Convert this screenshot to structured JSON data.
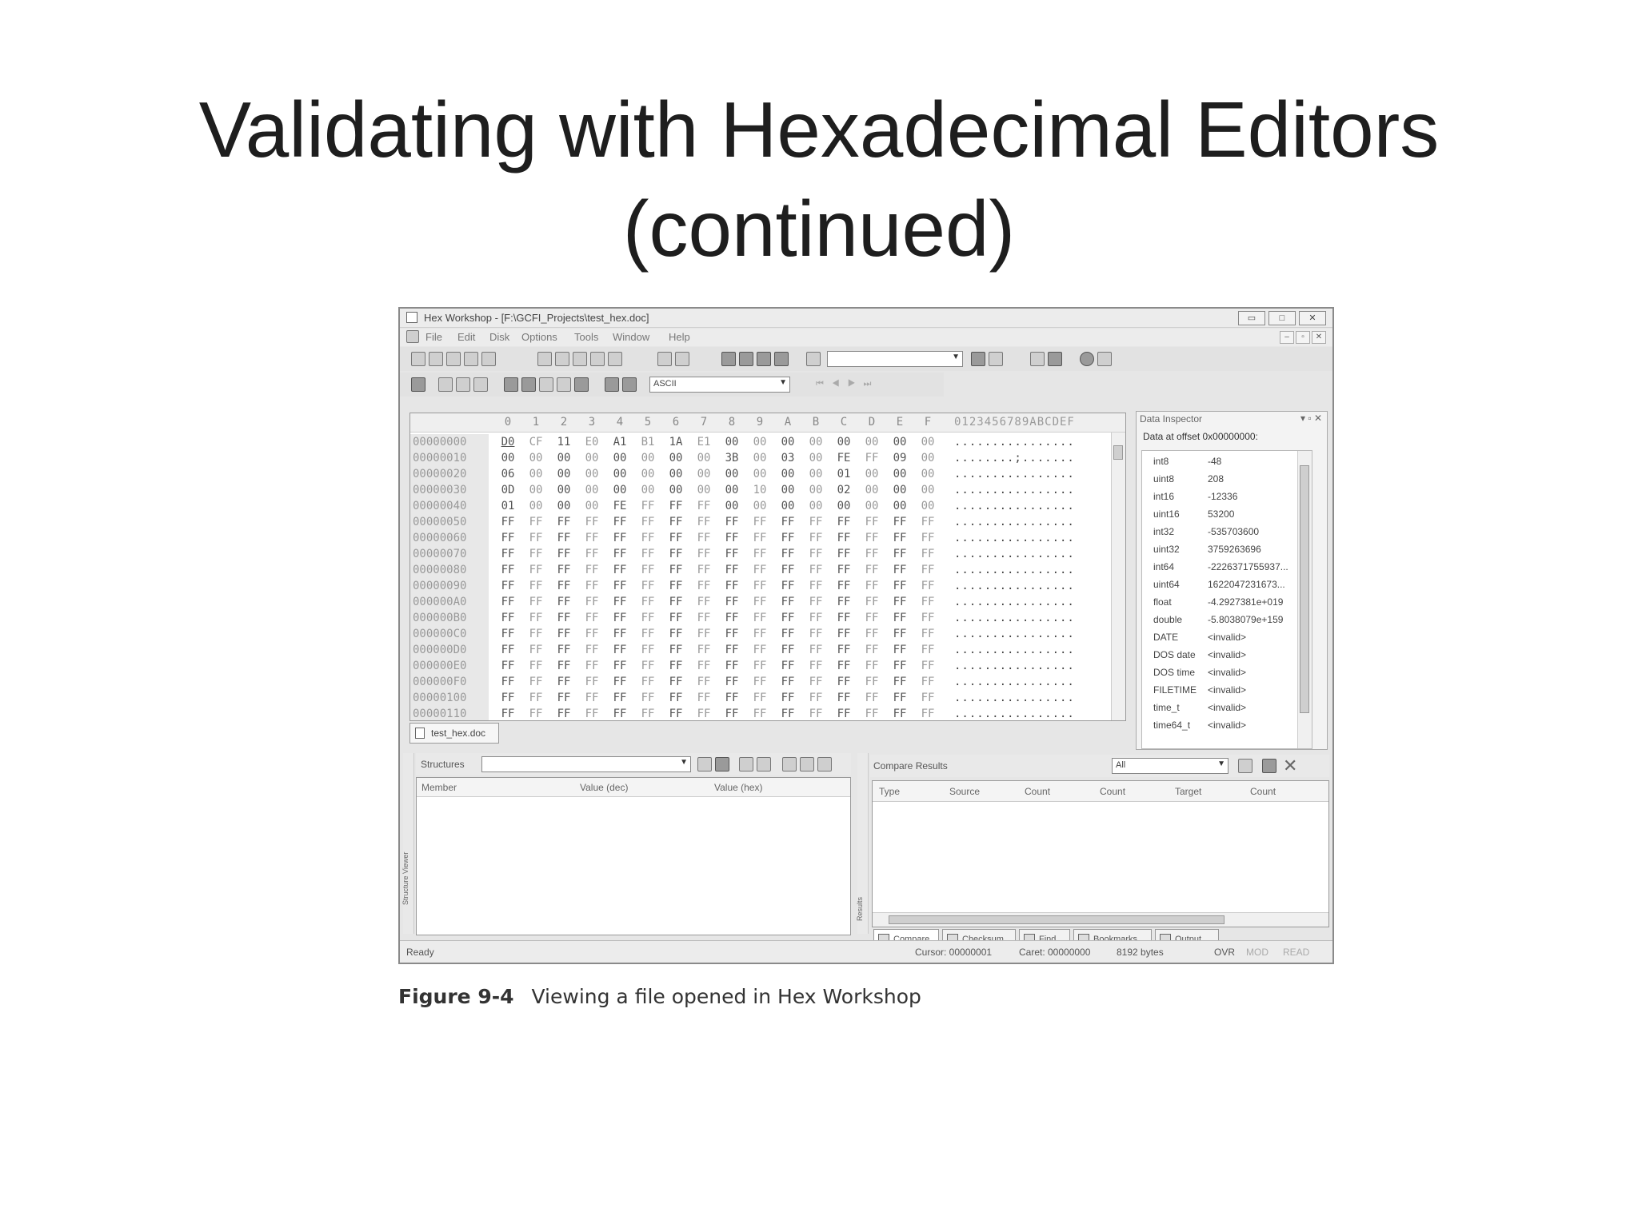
{
  "slide": {
    "title_line1": "Validating with Hexadecimal Editors",
    "title_line2": "(continued)",
    "caption_label": "Figure 9-4",
    "caption_text": "Viewing a file opened in Hex Workshop"
  },
  "window": {
    "title": "Hex Workshop - [F:\\GCFI_Projects\\test_hex.doc]",
    "controls": [
      "▭",
      "□",
      "✕"
    ],
    "mdi_controls": [
      "–",
      "▫",
      "✕"
    ]
  },
  "menu": [
    "File",
    "Edit",
    "Disk",
    "Options",
    "Tools",
    "Window",
    "Help"
  ],
  "toolbar": {
    "search_value": "",
    "encoding_value": "ASCII"
  },
  "hex": {
    "columns": [
      "0",
      "1",
      "2",
      "3",
      "4",
      "5",
      "6",
      "7",
      "8",
      "9",
      "A",
      "B",
      "C",
      "D",
      "E",
      "F"
    ],
    "ascii_header": "0123456789ABCDEF",
    "rows": [
      {
        "offset": "00000000",
        "bytes": [
          "D0",
          "CF",
          "11",
          "E0",
          "A1",
          "B1",
          "1A",
          "E1",
          "00",
          "00",
          "00",
          "00",
          "00",
          "00",
          "00",
          "00"
        ],
        "ascii": "................"
      },
      {
        "offset": "00000010",
        "bytes": [
          "00",
          "00",
          "00",
          "00",
          "00",
          "00",
          "00",
          "00",
          "3B",
          "00",
          "03",
          "00",
          "FE",
          "FF",
          "09",
          "00"
        ],
        "ascii": "........;......."
      },
      {
        "offset": "00000020",
        "bytes": [
          "06",
          "00",
          "00",
          "00",
          "00",
          "00",
          "00",
          "00",
          "00",
          "00",
          "00",
          "00",
          "01",
          "00",
          "00",
          "00"
        ],
        "ascii": "................"
      },
      {
        "offset": "00000030",
        "bytes": [
          "0D",
          "00",
          "00",
          "00",
          "00",
          "00",
          "00",
          "00",
          "00",
          "10",
          "00",
          "00",
          "02",
          "00",
          "00",
          "00"
        ],
        "ascii": "................"
      },
      {
        "offset": "00000040",
        "bytes": [
          "01",
          "00",
          "00",
          "00",
          "FE",
          "FF",
          "FF",
          "FF",
          "00",
          "00",
          "00",
          "00",
          "00",
          "00",
          "00",
          "00"
        ],
        "ascii": "................"
      },
      {
        "offset": "00000050",
        "bytes": [
          "FF",
          "FF",
          "FF",
          "FF",
          "FF",
          "FF",
          "FF",
          "FF",
          "FF",
          "FF",
          "FF",
          "FF",
          "FF",
          "FF",
          "FF",
          "FF"
        ],
        "ascii": "................"
      },
      {
        "offset": "00000060",
        "bytes": [
          "FF",
          "FF",
          "FF",
          "FF",
          "FF",
          "FF",
          "FF",
          "FF",
          "FF",
          "FF",
          "FF",
          "FF",
          "FF",
          "FF",
          "FF",
          "FF"
        ],
        "ascii": "................"
      },
      {
        "offset": "00000070",
        "bytes": [
          "FF",
          "FF",
          "FF",
          "FF",
          "FF",
          "FF",
          "FF",
          "FF",
          "FF",
          "FF",
          "FF",
          "FF",
          "FF",
          "FF",
          "FF",
          "FF"
        ],
        "ascii": "................"
      },
      {
        "offset": "00000080",
        "bytes": [
          "FF",
          "FF",
          "FF",
          "FF",
          "FF",
          "FF",
          "FF",
          "FF",
          "FF",
          "FF",
          "FF",
          "FF",
          "FF",
          "FF",
          "FF",
          "FF"
        ],
        "ascii": "................"
      },
      {
        "offset": "00000090",
        "bytes": [
          "FF",
          "FF",
          "FF",
          "FF",
          "FF",
          "FF",
          "FF",
          "FF",
          "FF",
          "FF",
          "FF",
          "FF",
          "FF",
          "FF",
          "FF",
          "FF"
        ],
        "ascii": "................"
      },
      {
        "offset": "000000A0",
        "bytes": [
          "FF",
          "FF",
          "FF",
          "FF",
          "FF",
          "FF",
          "FF",
          "FF",
          "FF",
          "FF",
          "FF",
          "FF",
          "FF",
          "FF",
          "FF",
          "FF"
        ],
        "ascii": "................"
      },
      {
        "offset": "000000B0",
        "bytes": [
          "FF",
          "FF",
          "FF",
          "FF",
          "FF",
          "FF",
          "FF",
          "FF",
          "FF",
          "FF",
          "FF",
          "FF",
          "FF",
          "FF",
          "FF",
          "FF"
        ],
        "ascii": "................"
      },
      {
        "offset": "000000C0",
        "bytes": [
          "FF",
          "FF",
          "FF",
          "FF",
          "FF",
          "FF",
          "FF",
          "FF",
          "FF",
          "FF",
          "FF",
          "FF",
          "FF",
          "FF",
          "FF",
          "FF"
        ],
        "ascii": "................"
      },
      {
        "offset": "000000D0",
        "bytes": [
          "FF",
          "FF",
          "FF",
          "FF",
          "FF",
          "FF",
          "FF",
          "FF",
          "FF",
          "FF",
          "FF",
          "FF",
          "FF",
          "FF",
          "FF",
          "FF"
        ],
        "ascii": "................"
      },
      {
        "offset": "000000E0",
        "bytes": [
          "FF",
          "FF",
          "FF",
          "FF",
          "FF",
          "FF",
          "FF",
          "FF",
          "FF",
          "FF",
          "FF",
          "FF",
          "FF",
          "FF",
          "FF",
          "FF"
        ],
        "ascii": "................"
      },
      {
        "offset": "000000F0",
        "bytes": [
          "FF",
          "FF",
          "FF",
          "FF",
          "FF",
          "FF",
          "FF",
          "FF",
          "FF",
          "FF",
          "FF",
          "FF",
          "FF",
          "FF",
          "FF",
          "FF"
        ],
        "ascii": "................"
      },
      {
        "offset": "00000100",
        "bytes": [
          "FF",
          "FF",
          "FF",
          "FF",
          "FF",
          "FF",
          "FF",
          "FF",
          "FF",
          "FF",
          "FF",
          "FF",
          "FF",
          "FF",
          "FF",
          "FF"
        ],
        "ascii": "................"
      },
      {
        "offset": "00000110",
        "bytes": [
          "FF",
          "FF",
          "FF",
          "FF",
          "FF",
          "FF",
          "FF",
          "FF",
          "FF",
          "FF",
          "FF",
          "FF",
          "FF",
          "FF",
          "FF",
          "FF"
        ],
        "ascii": "................"
      }
    ],
    "doc_tab": "test_hex.doc"
  },
  "inspector": {
    "title": "Data Inspector",
    "buttons": "▾ ▫ ✕",
    "offset_label": "Data at offset 0x00000000:",
    "rows": [
      {
        "key": "int8",
        "value": "-48"
      },
      {
        "key": "uint8",
        "value": "208"
      },
      {
        "key": "int16",
        "value": "-12336"
      },
      {
        "key": "uint16",
        "value": "53200"
      },
      {
        "key": "int32",
        "value": "-535703600"
      },
      {
        "key": "uint32",
        "value": "3759263696"
      },
      {
        "key": "int64",
        "value": "-2226371755937..."
      },
      {
        "key": "uint64",
        "value": "1622047231673..."
      },
      {
        "key": "float",
        "value": "-4.2927381e+019"
      },
      {
        "key": "double",
        "value": "-5.8038079e+159"
      },
      {
        "key": "DATE",
        "value": "<invalid>"
      },
      {
        "key": "DOS date",
        "value": "<invalid>"
      },
      {
        "key": "DOS time",
        "value": "<invalid>"
      },
      {
        "key": "FILETIME",
        "value": "<invalid>"
      },
      {
        "key": "time_t",
        "value": "<invalid>"
      },
      {
        "key": "time64_t",
        "value": "<invalid>"
      }
    ]
  },
  "structures": {
    "label": "Structures",
    "combo_value": "",
    "columns": [
      "Member",
      "Value (dec)",
      "Value (hex)"
    ],
    "side_label": "Structure Viewer"
  },
  "compare": {
    "label": "Compare Results",
    "filter_value": "All",
    "columns": [
      "Type",
      "Source",
      "Count",
      "Count",
      "Target",
      "Count"
    ],
    "side_label": "Results",
    "tabs": [
      "Compare",
      "Checksum",
      "Find",
      "Bookmarks",
      "Output"
    ]
  },
  "status": {
    "ready": "Ready",
    "cursor": "Cursor: 00000001",
    "caret": "Caret: 00000000",
    "size": "8192 bytes",
    "ovr": "OVR",
    "mod": "MOD",
    "read": "READ"
  }
}
